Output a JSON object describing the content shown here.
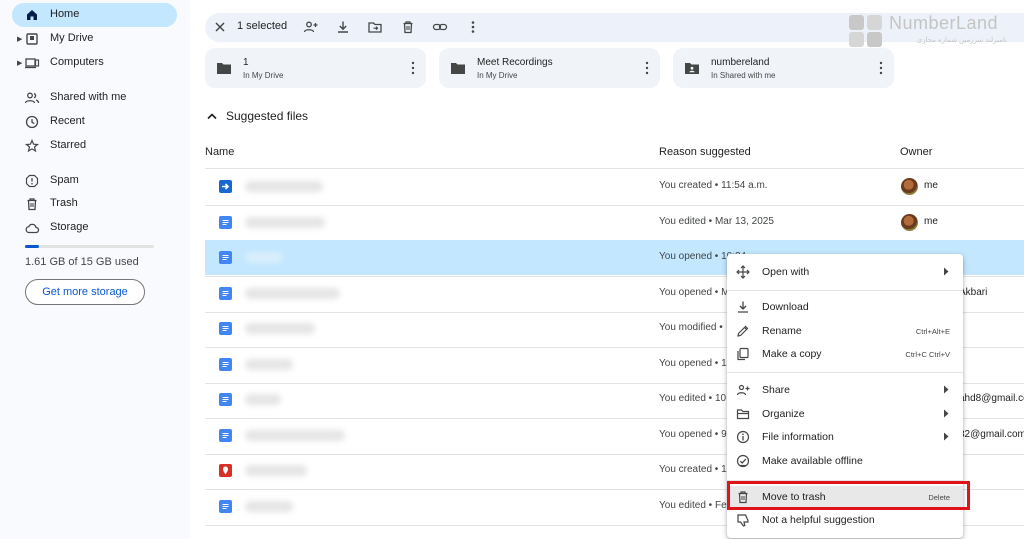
{
  "sidebar": {
    "items": [
      {
        "label": "Home",
        "icon": "home-icon",
        "active": true
      },
      {
        "label": "My Drive",
        "icon": "my-drive-icon"
      },
      {
        "label": "Computers",
        "icon": "computers-icon"
      },
      {
        "label": "Shared with me",
        "icon": "shared-icon"
      },
      {
        "label": "Recent",
        "icon": "clock-icon"
      },
      {
        "label": "Starred",
        "icon": "star-icon"
      },
      {
        "label": "Spam",
        "icon": "spam-icon"
      },
      {
        "label": "Trash",
        "icon": "trash-icon"
      },
      {
        "label": "Storage",
        "icon": "cloud-icon"
      }
    ],
    "storage_text": "1.61 GB of 15 GB used",
    "storage_used_fraction": 0.107,
    "get_storage_label": "Get more storage"
  },
  "toolbar": {
    "selected_label": "1 selected"
  },
  "folders": [
    {
      "name": "1",
      "location": "In My Drive",
      "icon": "folder-icon"
    },
    {
      "name": "Meet Recordings",
      "location": "In My Drive",
      "icon": "folder-icon"
    },
    {
      "name": "numbereland",
      "location": "In Shared with me",
      "icon": "shared-folder-icon"
    }
  ],
  "section": {
    "title": "Suggested files"
  },
  "table": {
    "headers": {
      "name": "Name",
      "reason": "Reason suggested",
      "owner": "Owner"
    },
    "rows": [
      {
        "reason": "You created • 11:54 a.m.",
        "owner": "me",
        "type": "form"
      },
      {
        "reason": "You edited • Mar 13, 2025",
        "owner": "me",
        "type": "doc"
      },
      {
        "reason": "You opened • 10:24",
        "owner": "",
        "type": "doc",
        "selected": true
      },
      {
        "reason": "You opened • M",
        "owner": "Akbari",
        "type": "doc"
      },
      {
        "reason": "You modified •",
        "owner": "",
        "type": "doc"
      },
      {
        "reason": "You opened • 1",
        "owner": "",
        "type": "doc"
      },
      {
        "reason": "You edited • 10",
        "owner": "ahd8@gmail.co",
        "type": "doc"
      },
      {
        "reason": "You opened • 9",
        "owner": "32@gmail.com",
        "type": "doc"
      },
      {
        "reason": "You created • 1",
        "owner": "",
        "type": "red"
      },
      {
        "reason": "You edited • Fe",
        "owner": "",
        "type": "doc"
      }
    ]
  },
  "context_menu": {
    "items": [
      {
        "label": "Open with",
        "icon": "move-arrows-icon",
        "submenu": true
      },
      {
        "label": "Download",
        "icon": "download-icon"
      },
      {
        "label": "Rename",
        "icon": "pencil-icon",
        "shortcut": "Ctrl+Alt+E"
      },
      {
        "label": "Make a copy",
        "icon": "copy-icon",
        "shortcut": "Ctrl+C Ctrl+V"
      },
      {
        "label": "Share",
        "icon": "person-add-icon",
        "submenu": true
      },
      {
        "label": "Organize",
        "icon": "folder-open-icon",
        "submenu": true
      },
      {
        "label": "File information",
        "icon": "info-icon",
        "submenu": true
      },
      {
        "label": "Make available offline",
        "icon": "offline-check-icon"
      },
      {
        "label": "Move to trash",
        "icon": "trash-icon",
        "shortcut": "Delete",
        "highlighted": true
      },
      {
        "label": "Not a helpful suggestion",
        "icon": "thumbs-down-icon"
      }
    ]
  },
  "watermark": {
    "name": "NumberLand",
    "subtitle": "نامبرلند سرزمین شماره مجازی"
  },
  "colors": {
    "accent": "#0b57d0",
    "selected_row": "#c2e7ff",
    "highlight_box": "#e0131a"
  }
}
